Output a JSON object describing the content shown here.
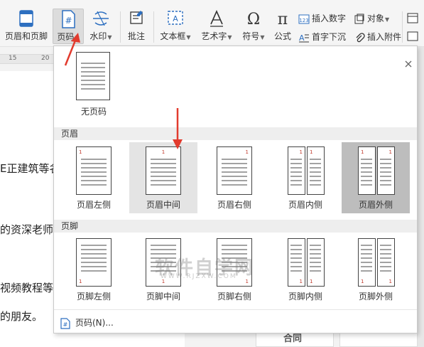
{
  "ribbon": {
    "header_footer": "页眉和页脚",
    "page_number": "页码",
    "watermark": "水印",
    "annotation": "批注",
    "textbox": "文本框",
    "wordart": "艺术字",
    "symbol": "符号",
    "formula": "公式",
    "insert_number": "插入数字",
    "object": "对象",
    "drop_cap": "首字下沉",
    "insert_attachment": "插入附件"
  },
  "ruler": {
    "ticks": [
      "15",
      "20"
    ]
  },
  "document": {
    "lines": [
      "E正建筑等名",
      "的资深老师",
      "视频教程等",
      "的朋友。"
    ]
  },
  "dropdown": {
    "no_page_number": "无页码",
    "header_section": "页眉",
    "footer_section": "页脚",
    "header_options": [
      "页眉左侧",
      "页眉中间",
      "页眉右侧",
      "页眉内侧",
      "页眉外侧"
    ],
    "footer_options": [
      "页脚左侧",
      "页脚中间",
      "页脚右侧",
      "页脚内侧",
      "页脚外侧"
    ],
    "page_number_digit": "1",
    "footer_link": "页码(N)..."
  },
  "background": {
    "partial_heading": "合同"
  },
  "watermark": {
    "text": "软件自学网",
    "sub": "WWW.RJZXW.COM"
  },
  "colors": {
    "accent": "#2d6fc0",
    "arrow": "#e23b2e",
    "selected_bg": "#bdbdbd",
    "hover_bg": "#e4e4e4"
  }
}
